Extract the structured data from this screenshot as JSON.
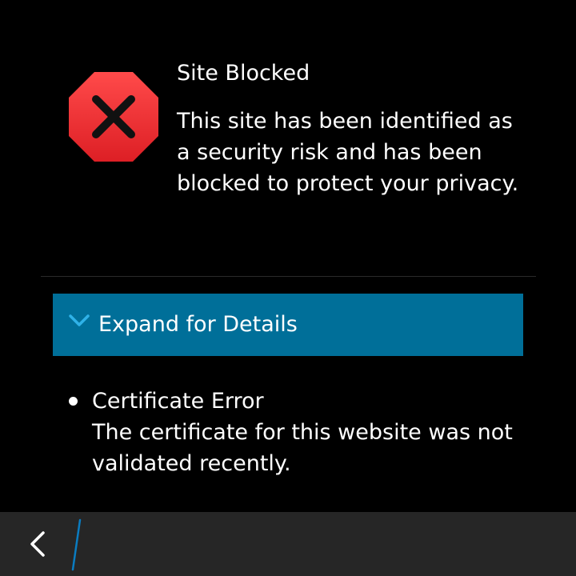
{
  "dialog": {
    "title": "Site Blocked",
    "message": "This site has been identified as a security risk and has been blocked to protect your privacy.",
    "icon": "stop-x-icon"
  },
  "expand": {
    "label": "Expand for Details",
    "icon": "chevron-down-icon"
  },
  "details": [
    {
      "title": "Certificate Error",
      "body": "The certificate for this website was not validated recently."
    }
  ],
  "toolbar": {
    "back_icon": "back-arrow-icon"
  },
  "colors": {
    "background": "#000000",
    "stop_red": "#e8262d",
    "expand_bar": "#006f99",
    "chevron": "#2fb2e8",
    "toolbar": "#262626",
    "accent_slash": "#0a7cc1"
  }
}
